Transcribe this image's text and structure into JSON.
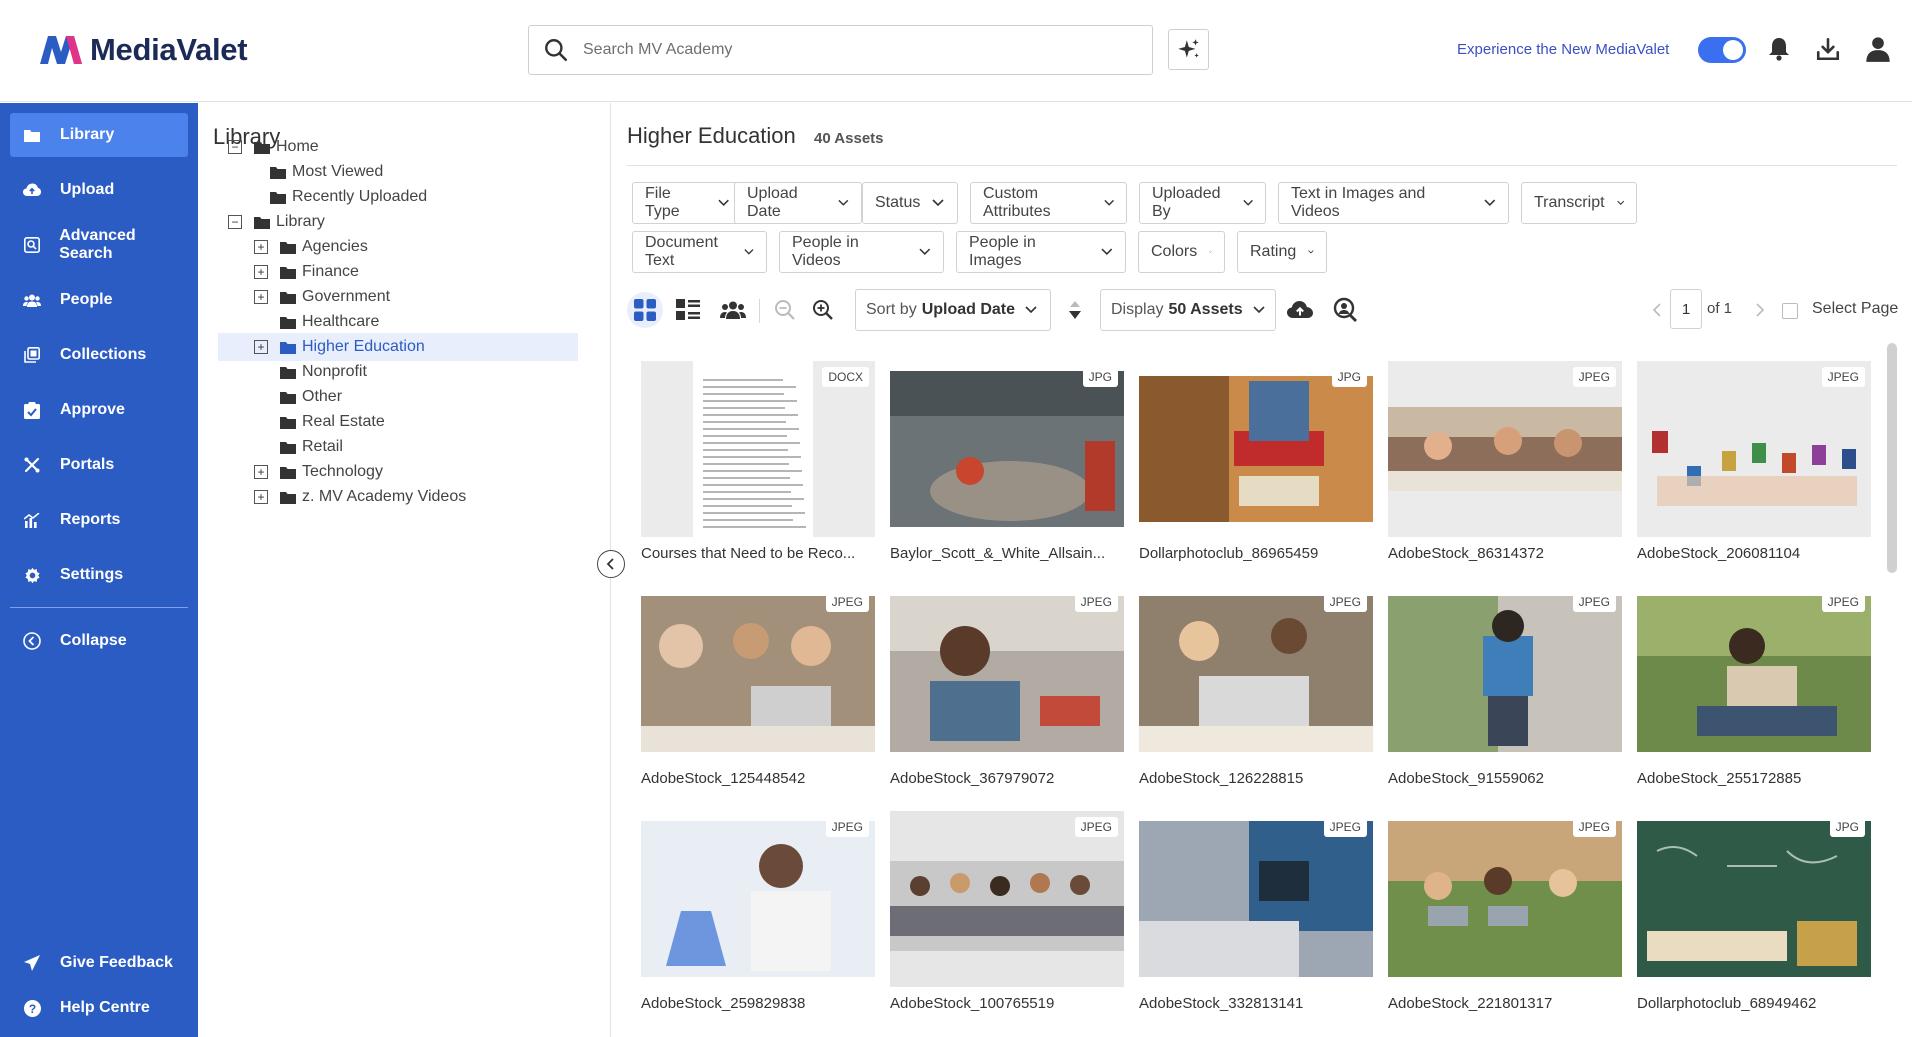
{
  "header": {
    "brand": "MediaValet",
    "search_placeholder": "Search MV Academy",
    "experience_link": "Experience the New MediaValet"
  },
  "sidebar": {
    "items": [
      {
        "label": "Library",
        "icon": "folder-icon"
      },
      {
        "label": "Upload",
        "icon": "upload-icon"
      },
      {
        "label": "Advanced Search",
        "icon": "advanced-search-icon"
      },
      {
        "label": "People",
        "icon": "people-icon"
      },
      {
        "label": "Collections",
        "icon": "collections-icon"
      },
      {
        "label": "Approve",
        "icon": "approve-icon"
      },
      {
        "label": "Portals",
        "icon": "portals-icon"
      },
      {
        "label": "Reports",
        "icon": "reports-icon"
      },
      {
        "label": "Settings",
        "icon": "gear-icon"
      },
      {
        "label": "Collapse",
        "icon": "collapse-icon"
      }
    ],
    "feedback": "Give Feedback",
    "help": "Help Centre"
  },
  "tree": {
    "title": "Library",
    "nodes": [
      {
        "label": "Home",
        "toggle": "−"
      },
      {
        "label": "Most Viewed"
      },
      {
        "label": "Recently Uploaded"
      },
      {
        "label": "Library",
        "toggle": "−"
      },
      {
        "label": "Agencies",
        "toggle": "+"
      },
      {
        "label": "Finance",
        "toggle": "+"
      },
      {
        "label": "Government",
        "toggle": "+"
      },
      {
        "label": "Healthcare"
      },
      {
        "label": "Higher Education",
        "toggle": "+"
      },
      {
        "label": "Nonprofit"
      },
      {
        "label": "Other"
      },
      {
        "label": "Real Estate"
      },
      {
        "label": "Retail"
      },
      {
        "label": "Technology",
        "toggle": "+"
      },
      {
        "label": "z. MV Academy Videos",
        "toggle": "+"
      }
    ]
  },
  "main": {
    "title": "Higher Education",
    "count": "40 Assets",
    "filters": [
      "File Type",
      "Upload Date",
      "Status",
      "Custom Attributes",
      "Uploaded By",
      "Text in Images and Videos",
      "Transcript",
      "Document Text",
      "People in Videos",
      "People in Images",
      "Colors",
      "Rating"
    ],
    "sort_prefix": "Sort by",
    "sort_value": "Upload Date",
    "display_prefix": "Display",
    "display_value": "50 Assets",
    "page": "1",
    "page_of": "of 1",
    "select_page": "Select Page"
  },
  "assets": [
    {
      "name": "Courses that Need to be Reco...",
      "type": "DOCX"
    },
    {
      "name": "Baylor_Scott_&_White_Allsain...",
      "type": "JPG"
    },
    {
      "name": "Dollarphotoclub_86965459",
      "type": "JPG"
    },
    {
      "name": "AdobeStock_86314372",
      "type": "JPEG"
    },
    {
      "name": "AdobeStock_206081104",
      "type": "JPEG"
    },
    {
      "name": "AdobeStock_125448542",
      "type": "JPEG"
    },
    {
      "name": "AdobeStock_367979072",
      "type": "JPEG"
    },
    {
      "name": "AdobeStock_126228815",
      "type": "JPEG"
    },
    {
      "name": "AdobeStock_91559062",
      "type": "JPEG"
    },
    {
      "name": "AdobeStock_255172885",
      "type": "JPEG"
    },
    {
      "name": "AdobeStock_259829838",
      "type": "JPEG"
    },
    {
      "name": "AdobeStock_100765519",
      "type": "JPEG"
    },
    {
      "name": "AdobeStock_332813141",
      "type": "JPEG"
    },
    {
      "name": "AdobeStock_221801317",
      "type": "JPEG"
    },
    {
      "name": "Dollarphotoclub_68949462",
      "type": "JPG"
    }
  ]
}
